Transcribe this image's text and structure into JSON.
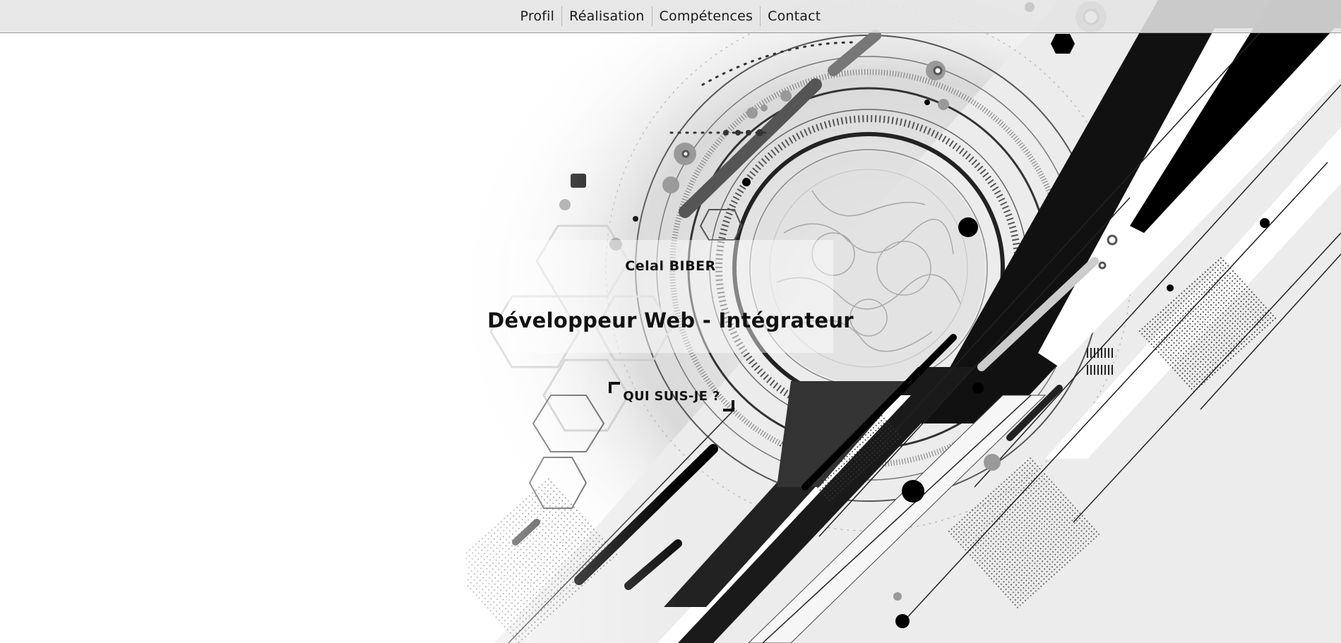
{
  "nav": {
    "items": [
      {
        "label": "Profil"
      },
      {
        "label": "Réalisation"
      },
      {
        "label": "Compétences"
      },
      {
        "label": "Contact"
      }
    ]
  },
  "hero": {
    "name": "Celal BIBER",
    "title": "Développeur Web - Intégrateur",
    "cta_label": "QUI SUIS-JE ?"
  },
  "colors": {
    "nav_background": "#e4e4e4",
    "text": "#111111",
    "art_primary": "#000000",
    "art_secondary": "#9e9e9e"
  }
}
